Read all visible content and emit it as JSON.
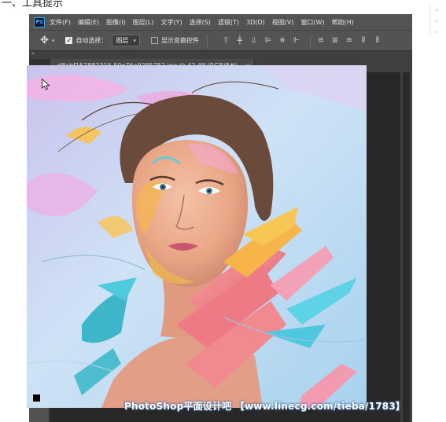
{
  "page": {
    "heading": "一、工具提示",
    "side_tabs": [
      "»",
      "»",
      "»"
    ]
  },
  "app": {
    "logo": "Ps",
    "menus": [
      "文件(F)",
      "编辑(E)",
      "图像(I)",
      "图层(L)",
      "文字(Y)",
      "选择(S)",
      "滤镜(T)",
      "3D(D)",
      "视图(V)",
      "窗口(W)",
      "帮助(H)"
    ]
  },
  "options": {
    "tool_icon": "move-icon",
    "auto_select_label": "自动选择：",
    "auto_select_checked": true,
    "auto_select_target": "图层",
    "show_transform_label": "显示变换控件",
    "show_transform_checked": false
  },
  "document": {
    "tab_title": "d8abf157882315.59e76a9285752.jpg @ 42.4%(RGB/8#)",
    "close_symbol": "×"
  },
  "tools": [
    {
      "name": "move-tool",
      "icon": "move-icon",
      "active": true
    },
    {
      "name": "marquee-tool",
      "icon": "marquee-icon"
    },
    {
      "name": "lasso-tool",
      "icon": "lasso-icon"
    },
    {
      "name": "quick-select-tool",
      "icon": "quick-select-icon"
    },
    {
      "name": "crop-tool",
      "icon": "crop-icon"
    },
    {
      "name": "eyedropper-tool",
      "icon": "eyedropper-icon"
    },
    {
      "name": "healing-brush-tool",
      "icon": "bandage-icon"
    },
    {
      "name": "brush-tool",
      "icon": "brush-icon"
    },
    {
      "name": "clone-stamp-tool",
      "icon": "stamp-icon"
    },
    {
      "name": "history-brush-tool",
      "icon": "history-brush-icon"
    },
    {
      "name": "eraser-tool",
      "icon": "eraser-icon"
    },
    {
      "name": "gradient-tool",
      "icon": "gradient-icon"
    },
    {
      "name": "blur-tool",
      "icon": "drop-icon"
    },
    {
      "name": "dodge-tool",
      "icon": "dodge-icon"
    },
    {
      "name": "pen-tool",
      "icon": "pen-icon"
    },
    {
      "name": "type-tool",
      "icon": "type-icon"
    },
    {
      "name": "path-select-tool",
      "icon": "arrow-icon"
    },
    {
      "name": "rectangle-tool",
      "icon": "rectangle-icon"
    },
    {
      "name": "hand-tool",
      "icon": "hand-icon"
    },
    {
      "name": "zoom-tool",
      "icon": "zoom-icon"
    },
    {
      "name": "more-tools",
      "icon": "ellipsis-icon"
    }
  ],
  "colors": {
    "foreground": "#000000",
    "background": "#ffffff",
    "ui_bg": "#535353",
    "canvas_bg": "#282828"
  },
  "watermark": "PhotoShop平面设计吧 【www.linecg.com/tieba/1783】"
}
